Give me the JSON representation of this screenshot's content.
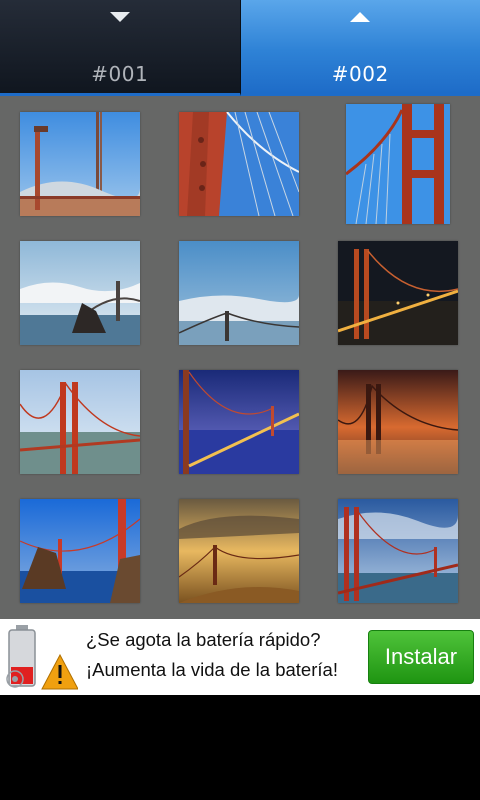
{
  "tabs": [
    {
      "label": "#001",
      "selected": false,
      "arrow": "chevron-down-icon"
    },
    {
      "label": "#002",
      "selected": true,
      "arrow": "chevron-up-icon"
    }
  ],
  "gallery": {
    "background": "#666766",
    "thumbnails": [
      {
        "subject": "bridge-tower-beach-lamp"
      },
      {
        "subject": "bridge-tower-closeup"
      },
      {
        "subject": "bridge-tower-sky"
      },
      {
        "subject": "bridge-rock-bay"
      },
      {
        "subject": "bridge-fog"
      },
      {
        "subject": "bridge-night-lights"
      },
      {
        "subject": "bridge-daytime-bay"
      },
      {
        "subject": "bridge-dusk-lights"
      },
      {
        "subject": "bridge-sunset-fog"
      },
      {
        "subject": "bridge-rock-fog-blue"
      },
      {
        "subject": "bridge-golden-hills"
      },
      {
        "subject": "bridge-hdr-clouds"
      }
    ]
  },
  "ad": {
    "line1": "¿Se agota la batería rápido?",
    "line2": "¡Aumenta la vida de la batería!",
    "button": "Instalar",
    "icon": "battery-warning-icon",
    "button_color": "#2ea81f"
  }
}
